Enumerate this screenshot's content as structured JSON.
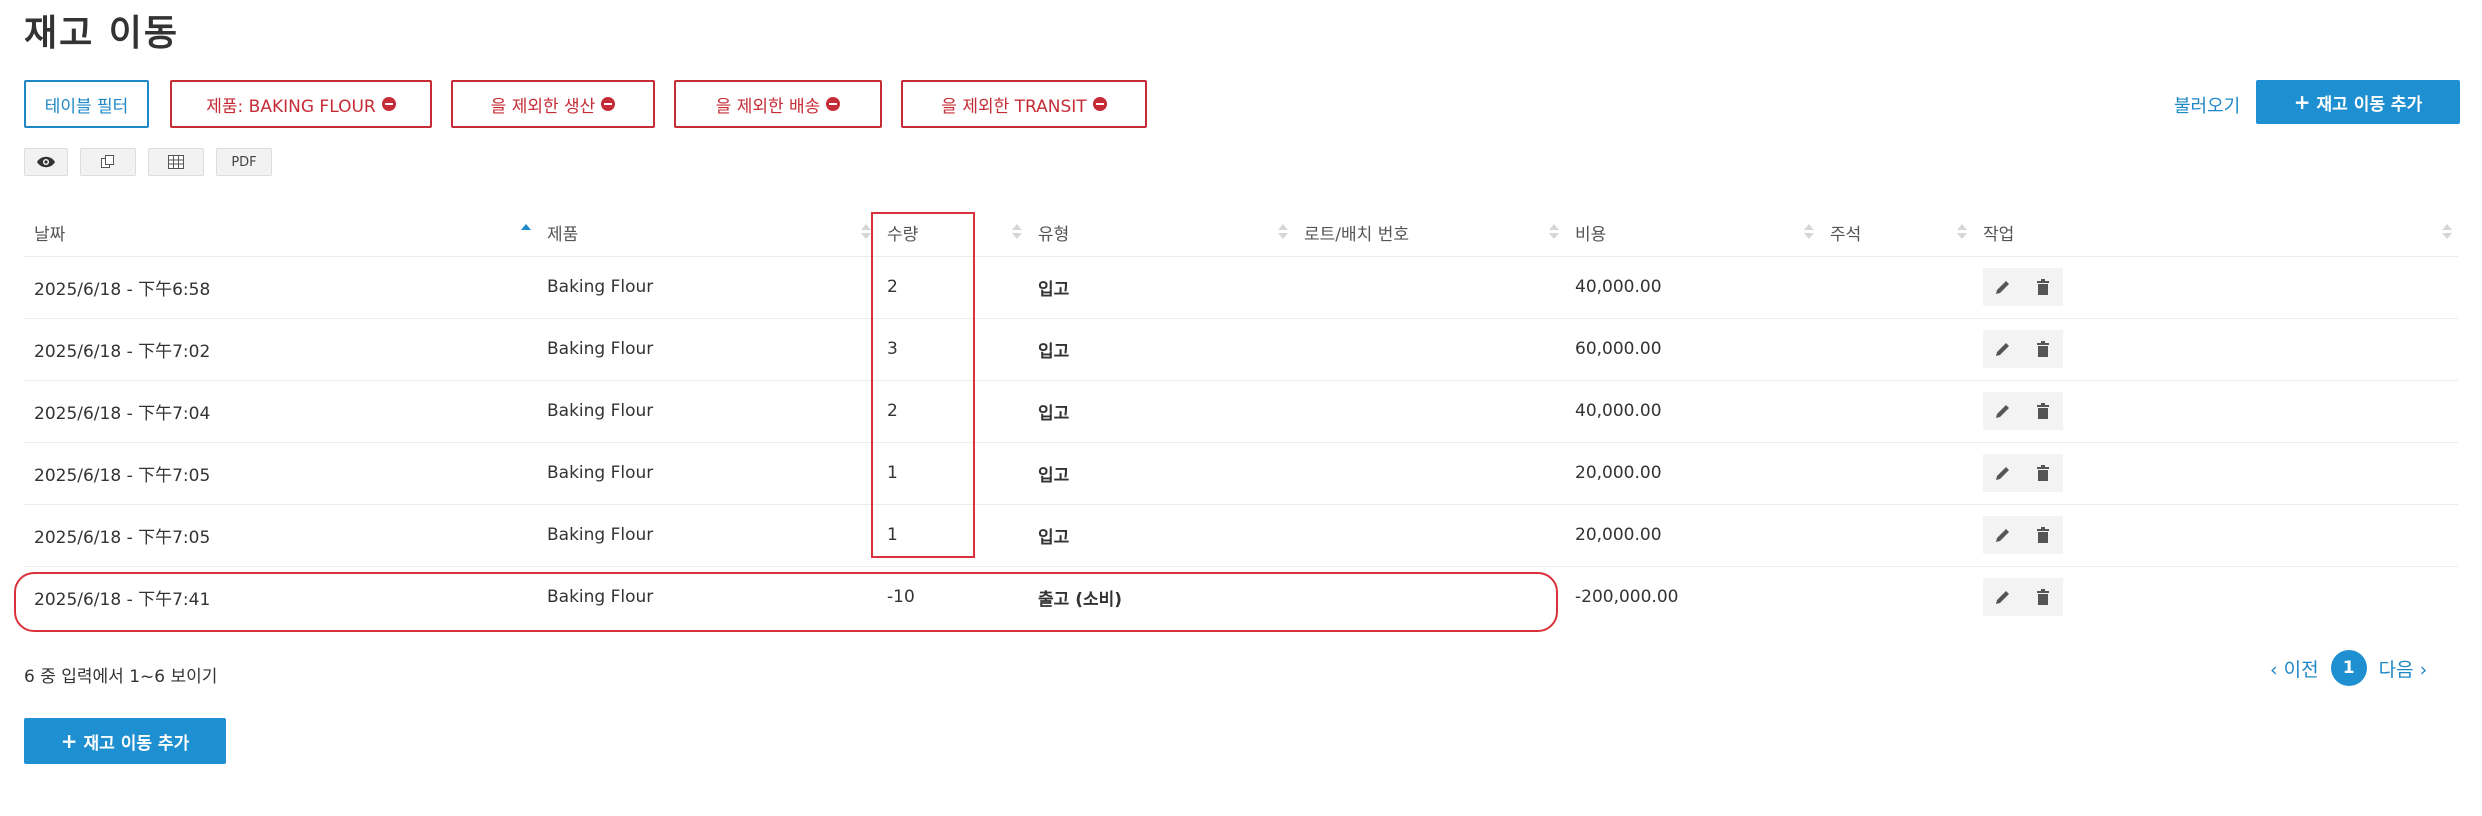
{
  "page": {
    "title": "재고 이동"
  },
  "filters": {
    "table_filter_label": "테이블 필터",
    "chips": [
      {
        "label": "제품: BAKING FLOUR"
      },
      {
        "label": "을 제외한 생산"
      },
      {
        "label": "을 제외한 배송"
      },
      {
        "label": "을 제외한 TRANSIT"
      }
    ]
  },
  "top_actions": {
    "load_label": "불러오기",
    "add_label": "재고 이동 추가"
  },
  "tools": {
    "pdf_label": "PDF"
  },
  "table": {
    "columns": [
      "날짜",
      "제품",
      "수량",
      "유형",
      "로트/배치 번호",
      "비용",
      "주석",
      "작업"
    ],
    "sort": {
      "column": "날짜",
      "direction": "ascending"
    },
    "rows": [
      {
        "date": "2025/6/18 - 下午6:58",
        "product": "Baking Flour",
        "qty": "2",
        "type": "입고",
        "lot": "",
        "cost": "40,000.00",
        "note": ""
      },
      {
        "date": "2025/6/18 - 下午7:02",
        "product": "Baking Flour",
        "qty": "3",
        "type": "입고",
        "lot": "",
        "cost": "60,000.00",
        "note": ""
      },
      {
        "date": "2025/6/18 - 下午7:04",
        "product": "Baking Flour",
        "qty": "2",
        "type": "입고",
        "lot": "",
        "cost": "40,000.00",
        "note": ""
      },
      {
        "date": "2025/6/18 - 下午7:05",
        "product": "Baking Flour",
        "qty": "1",
        "type": "입고",
        "lot": "",
        "cost": "20,000.00",
        "note": ""
      },
      {
        "date": "2025/6/18 - 下午7:05",
        "product": "Baking Flour",
        "qty": "1",
        "type": "입고",
        "lot": "",
        "cost": "20,000.00",
        "note": ""
      },
      {
        "date": "2025/6/18 - 下午7:41",
        "product": "Baking Flour",
        "qty": "-10",
        "type": "출고 (소비)",
        "lot": "",
        "cost": "-200,000.00",
        "note": ""
      }
    ]
  },
  "footer": {
    "entries_info": "6 중 입력에서 1~6 보이기",
    "prev_label": "‹ 이전",
    "page": "1",
    "next_label": "다음 ›",
    "add_label": "재고 이동 추가"
  },
  "colors": {
    "accent": "#1e8fd0",
    "danger": "#c62c36",
    "highlight": "#d9323a"
  },
  "icons": [
    "eye-icon",
    "copy-icon",
    "table-icon",
    "pencil-icon",
    "trash-icon",
    "minus-circle-icon",
    "plus-icon",
    "sort-icon"
  ]
}
